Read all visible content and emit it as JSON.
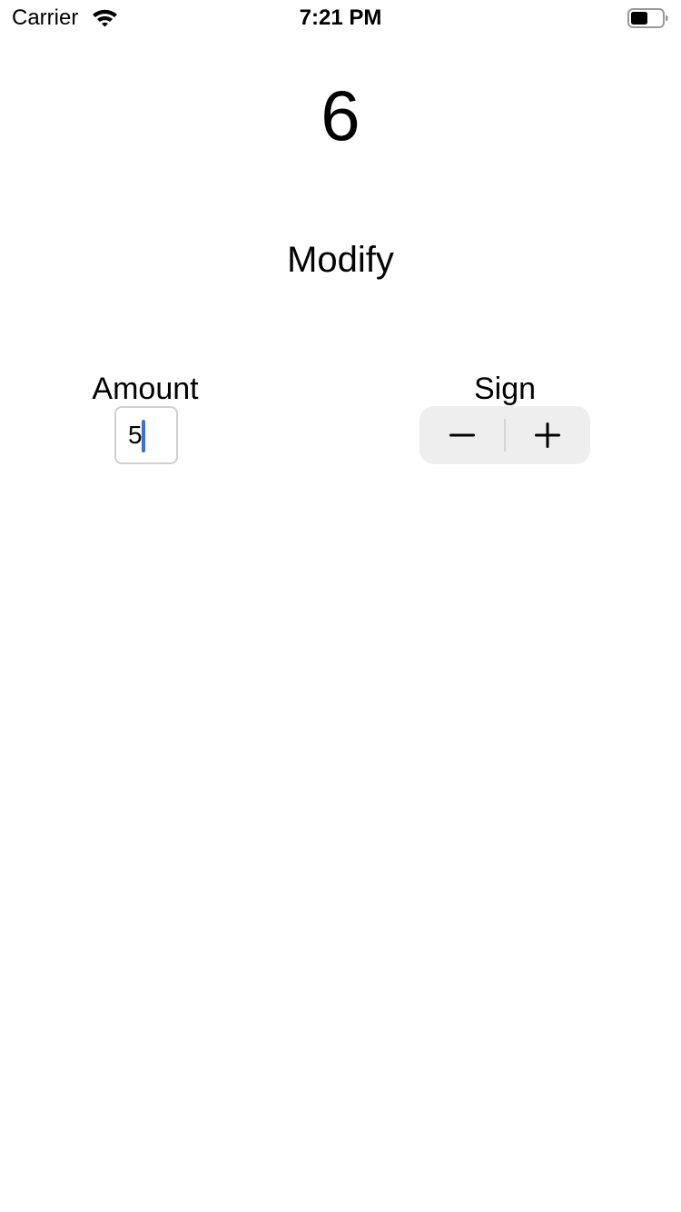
{
  "status_bar": {
    "carrier": "Carrier",
    "time": "7:21 PM",
    "wifi_icon": "wifi-icon",
    "battery_icon": "battery-icon"
  },
  "counter": {
    "value": "6"
  },
  "title": "Modify",
  "amount": {
    "label": "Amount",
    "value": "5"
  },
  "sign": {
    "label": "Sign",
    "minus_icon": "minus-icon",
    "plus_icon": "plus-icon"
  },
  "colors": {
    "caret": "#3e6fd8",
    "stepper_background": "#eeeeef",
    "field_border": "#d0d0d0"
  }
}
